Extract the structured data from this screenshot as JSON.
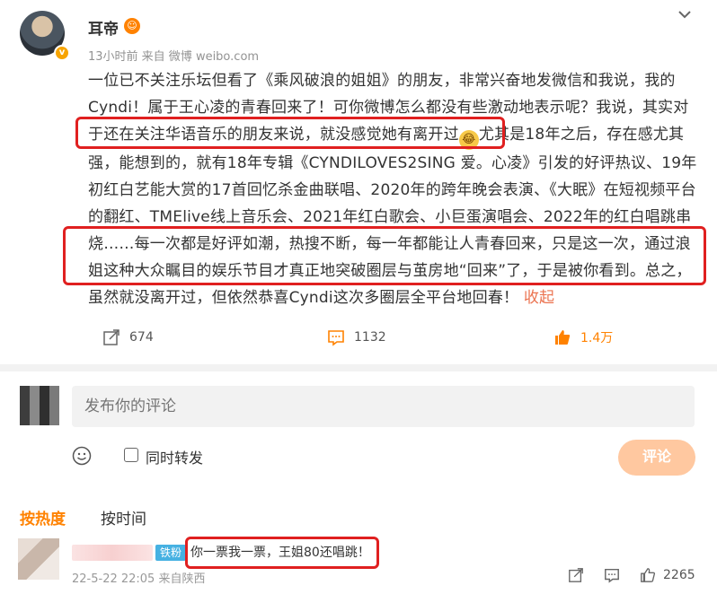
{
  "post": {
    "username": "耳帝",
    "user_badge": "☺",
    "meta": "13小时前  来自 微博 weibo.com",
    "text_1": "一位已不关注乐坛但看了《乘风破浪的姐姐》的朋友，非常兴奋地发微信和我说，我的Cyndi！属于王心凌的青春回来了！可你微博怎么都没有些激动地表示呢？我说，其实",
    "text_2": "对于还在关注华语音乐的朋友来说，就没感觉她有离开过",
    "text_3": "尤其是18年之后，存在感尤其强，能想到的，就有18年专辑《CYNDILOVES2SING 爱。心凌》引发的好评热议、19年初红白艺能大赏的17首回忆杀金曲联唱、2020年的跨年晚会表演、《大眠》在短视频平台的翻红、TMElive线上音乐会、2021年红白歌会、小巨蛋演唱会、2022年的红白唱跳串烧……每一次都是好评如潮，热搜不断，每一年都能让人青春回来，只是这一次，通过浪姐这种大众瞩目的娱乐节目才真正地突破圈层与茧房地“回来”了，于是被你看到。总之，虽然就没离开过，但依然恭喜Cyndi这次多圈层全平台地回春！",
    "collapse_label": "收起",
    "emoji_icon": "laughing-tears-emoji",
    "reposts": "674",
    "comments": "1132",
    "likes": "1.4万"
  },
  "composer": {
    "placeholder": "发布你的评论",
    "repost_label": "同时转发",
    "submit_label": "评论"
  },
  "sort": {
    "hot_label": "按热度",
    "time_label": "按时间"
  },
  "comment": {
    "fan_badge": "铁粉",
    "text": "你一票我一票，王姐80还唱跳！",
    "meta": "22-5-22 22:05  来自陕西",
    "likes": "2265"
  },
  "colors": {
    "accent": "#ff8200",
    "highlight_box": "#e02020",
    "collapse": "#eb7350",
    "submit_bg": "#ffc8a0"
  }
}
